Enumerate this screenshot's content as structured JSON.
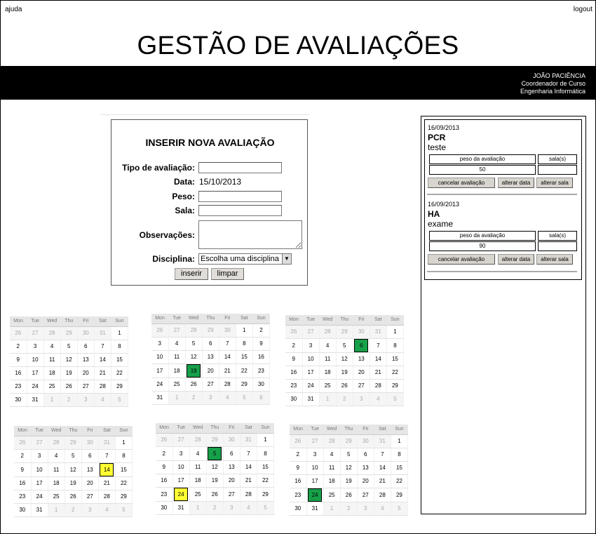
{
  "header": {
    "help": "ajuda",
    "logout": "logout",
    "title": "GESTÃO DE AVALIAÇÕES"
  },
  "user": {
    "name": "JOÃO PACIÊNCIA",
    "role": "Coordenador de Curso",
    "course": "Engenharia Informática"
  },
  "form": {
    "title": "INSERIR NOVA AVALIAÇÃO",
    "type_label": "Tipo de avaliação:",
    "date_label": "Data:",
    "date_value": "15/10/2013",
    "weight_label": "Peso:",
    "room_label": "Sala:",
    "notes_label": "Observações:",
    "subject_label": "Disciplina:",
    "subject_selected": "Escolha uma disciplina",
    "insert": "inserir",
    "clear": "limpar"
  },
  "evaluations": [
    {
      "date": "16/09/2013",
      "code": "PCR",
      "description": "teste",
      "weight_header": "peso da avaliação",
      "room_header": "sala(s)",
      "weight": "50",
      "room": "",
      "cancel": "cancelar avaliação",
      "change_date": "alterar data",
      "change_room": "alterar sala"
    },
    {
      "date": "16/09/2013",
      "code": "HA",
      "description": "exame",
      "weight_header": "peso da avaliação",
      "room_header": "sala(s)",
      "weight": "90",
      "room": "",
      "cancel": "cancelar avaliação",
      "change_date": "alterar data",
      "change_room": "alterar sala"
    }
  ],
  "calendar": {
    "weekdays": [
      "Mon",
      "Tue",
      "Wed",
      "Thu",
      "Fri",
      "Sat",
      "Sun"
    ],
    "months": [
      {
        "prev_start": 26,
        "prev_end": 31,
        "days": 31,
        "green": [],
        "yellow": []
      },
      {
        "prev_start": 26,
        "prev_end": 30,
        "days": 31,
        "green": [
          19
        ],
        "yellow": []
      },
      {
        "prev_start": 26,
        "prev_end": 31,
        "days": 31,
        "green": [
          6
        ],
        "yellow": []
      },
      {
        "prev_start": 26,
        "prev_end": 31,
        "days": 31,
        "green": [],
        "yellow": [
          14
        ]
      },
      {
        "prev_start": 26,
        "prev_end": 31,
        "days": 31,
        "green": [
          5
        ],
        "yellow": [
          24
        ]
      },
      {
        "prev_start": 26,
        "prev_end": 31,
        "days": 31,
        "green": [
          24
        ],
        "yellow": []
      }
    ],
    "colors": {
      "green": "#16a04a",
      "yellow": "#ffff33"
    }
  }
}
